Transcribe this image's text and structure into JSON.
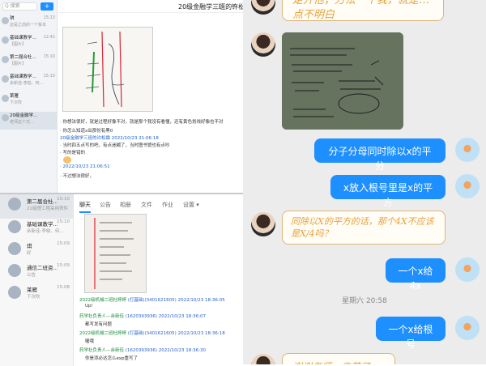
{
  "win1": {
    "search_placeholder": "Q 搜索",
    "plus": "+",
    "title": "20级金融学三班的许松霖",
    "controls": [
      "–",
      "□",
      "×"
    ],
    "chats": [
      {
        "name": "琪",
        "time": "15:13",
        "preview": "这是之前的一个板本"
      },
      {
        "name": "基础课教学…",
        "time": "12:42",
        "preview": "【图片】"
      },
      {
        "name": "第二届合杜…",
        "time": "15:10",
        "preview": "【图片】"
      },
      {
        "name": "基础课教学…",
        "time": "15:10",
        "preview": "余新佳:李柏、何…"
      },
      {
        "name": "莱雁",
        "time": "",
        "preview": "下次吹"
      },
      {
        "name": "20级金融学…",
        "time": "",
        "preview": "老师这个式…"
      }
    ],
    "messages": [
      "· 你想法很好，就是过程好像不对，就是那个我没有看懂，还有黄色划线好像也不对",
      "· 你怎么知道x出那份有黑0",
      "20级金融学三班的许松霖  2022/10/23 21:06:18",
      "· 当时四五点写的吧，有点迷糊了，当时图书馆也有点吵",
      "· 写的是错的",
      "· 2022/10/23 21:06:51",
      "· 不过想法很好，"
    ]
  },
  "win2": {
    "chats": [
      {
        "name": "第二届合杜…",
        "time": "15:10",
        "preview": "22级理工程采用表件"
      },
      {
        "name": "基础课教学…",
        "time": "15:10",
        "preview": "余新佳:李柏、何…"
      },
      {
        "name": "琪",
        "time": "15:09",
        "preview": "好"
      },
      {
        "name": "通信二班资…",
        "time": "15:09",
        "preview": "公告"
      },
      {
        "name": "莱雁",
        "time": "15:08",
        "preview": "下次吹"
      }
    ],
    "tabs": [
      "聊天",
      "公告",
      "相册",
      "文件",
      "作业",
      "设置 ▾"
    ],
    "messages": [
      {
        "who": "2022级机械二班杜婷婷",
        "meta": "(打基础)(3401621605) 2022/10/23 18:36:05",
        "text": "Up!"
      },
      {
        "who": "药学社负责人—余新佳",
        "meta": "(1620393936) 2022/10/23 18:36:07",
        "text": "都写发有问题"
      },
      {
        "who": "2022级机械二班杜婷婷",
        "meta": "(打基础)(3401621605) 2022/10/23 18:36:18",
        "text": "喔哦"
      },
      {
        "who": "药学社负责人—余新佳",
        "meta": "(1620393936) 2022/10/23 18:36:30",
        "text": "你是添必达怎么exp重写了"
      }
    ]
  },
  "right": {
    "top_note": "走开他，方法一个我，就是…点不明白",
    "bubbles": [
      {
        "text": "分子分母同时除以x的平分"
      },
      {
        "text": "x放入根号里是x的平方"
      },
      {
        "text": "同除以X的平方的话，那个4X不应该是X/4吗？"
      },
      {
        "text": "一个x给4x"
      },
      {
        "text": "一个x给根号"
      }
    ],
    "timestamp": "星期六 20:58",
    "bottom_note": "谢谢老师，辛苦了…"
  },
  "colors": {
    "accent": "#1e8fff",
    "note_text": "#e6a23c",
    "note_border": "#d9b57c"
  }
}
